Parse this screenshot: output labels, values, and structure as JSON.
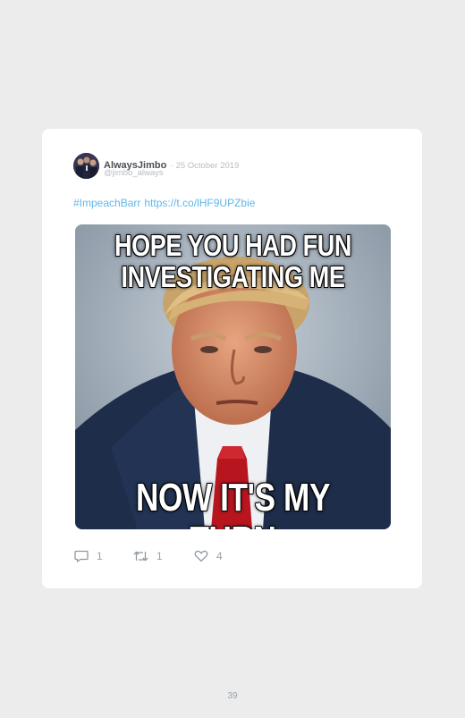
{
  "tweet": {
    "display_name": "AlwaysJimbo",
    "date": "· 25 October 2019",
    "handle": "@jimbo_always",
    "hashtag": "#ImpeachBarr",
    "link": "https://t.co/lHF9UPZbie",
    "media": {
      "caption_top_line1": "HOPE YOU HAD FUN",
      "caption_top_line2": "INVESTIGATING ME",
      "caption_bottom": "NOW IT'S MY TURN"
    },
    "actions": {
      "replies": "1",
      "retweets": "1",
      "likes": "4"
    }
  },
  "page": {
    "number": "39"
  },
  "colors": {
    "background": "#ececec",
    "card": "#ffffff",
    "link": "#5fb6ea",
    "muted": "#b7bcc4",
    "icon": "#9aa3ad"
  },
  "icons": [
    "reply-icon",
    "retweet-icon",
    "heart-icon"
  ]
}
